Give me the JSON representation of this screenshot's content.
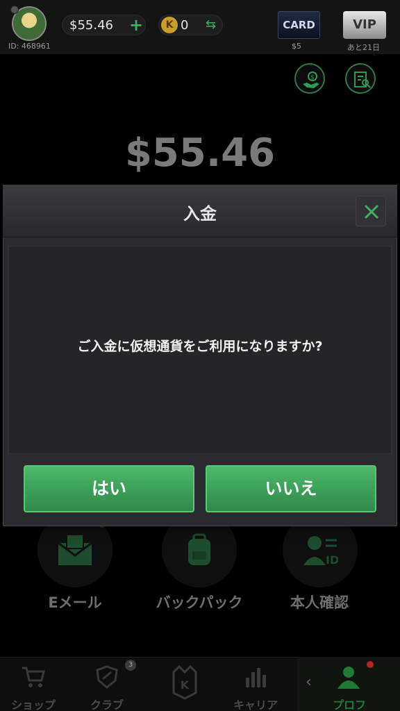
{
  "header": {
    "user_id": "ID: 468961",
    "balance": "$55.46",
    "plus_symbol": "+",
    "coin_icon_letter": "K",
    "coins": "0",
    "swap_symbol": "⇆",
    "card_label": "CARD",
    "card_price": "$5",
    "vip_label": "VIP",
    "vip_days": "あと21日"
  },
  "main": {
    "balance_big": "$55.46",
    "features": [
      {
        "label": "Eメール",
        "icon": "email-icon"
      },
      {
        "label": "バックパック",
        "icon": "backpack-icon"
      },
      {
        "label": "本人確認",
        "icon": "id-card-icon"
      }
    ]
  },
  "modal": {
    "title": "入金",
    "message": "ご入金に仮想通貨をご利用になりますか?",
    "yes_label": "はい",
    "no_label": "いいえ"
  },
  "nav": {
    "items": [
      {
        "label": "ショップ",
        "icon": "cart-icon"
      },
      {
        "label": "クラブ",
        "icon": "shield-icon",
        "badge": "3"
      },
      {
        "label": "",
        "icon": "logo-icon"
      },
      {
        "label": "キャリア",
        "icon": "bar-chart-icon"
      },
      {
        "label": "プロフ",
        "icon": "user-icon"
      }
    ],
    "back_symbol": "‹"
  },
  "colors": {
    "accent_green": "#3fb25c",
    "modal_bg": "#2b2b2f",
    "notification_red": "#b3261e"
  }
}
